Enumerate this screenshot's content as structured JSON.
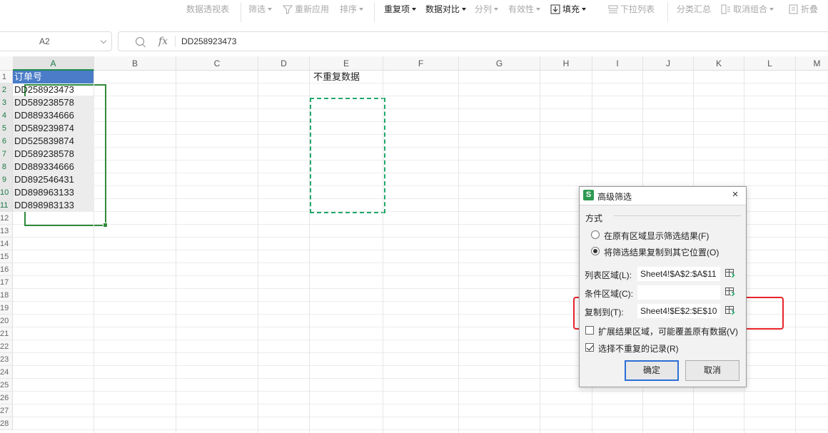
{
  "toolbar": {
    "pivot_table": "数据透视表",
    "filter": "筛选",
    "reapply": "重新应用",
    "sort": "排序",
    "duplicates": "重复项",
    "compare": "数据对比",
    "split_columns": "分列",
    "validity": "有效性",
    "fill": "填充",
    "dropdown_list": "下拉列表",
    "subtotal": "分类汇总",
    "ungroup": "取消组合",
    "fold": "折叠"
  },
  "formula_bar": {
    "name_box": "A2",
    "fx": "fx",
    "value": "DD258923473"
  },
  "sheet": {
    "columns": [
      "A",
      "B",
      "C",
      "D",
      "E",
      "F",
      "G",
      "H",
      "I",
      "J",
      "K",
      "L",
      "M"
    ],
    "row_labels": [
      "1",
      "2",
      "3",
      "4",
      "5",
      "6",
      "7",
      "8",
      "9",
      "10",
      "11",
      "12",
      "13",
      "14",
      "15",
      "16",
      "17",
      "18",
      "19",
      "20",
      "21",
      "22",
      "23",
      "24",
      "25",
      "26",
      "27",
      "28"
    ],
    "a1_header": "订单号",
    "e1_header": "不重复数据",
    "orders": [
      "DD258923473",
      "DD589238578",
      "DD889334666",
      "DD589239874",
      "DD525839874",
      "DD589238578",
      "DD889334666",
      "DD892546431",
      "DD898963133",
      "DD898983133"
    ]
  },
  "dialog": {
    "title": "高级筛选",
    "close": "×",
    "logo": "S",
    "mode_label": "方式",
    "option_in_place": "在原有区域显示筛选结果(F)",
    "option_copy": "将筛选结果复制到其它位置(O)",
    "list_range_label": "列表区域(L):",
    "list_range_value": "Sheet4!$A$2:$A$11",
    "criteria_label": "条件区域(C):",
    "criteria_value": "",
    "copy_to_label": "复制到(T):",
    "copy_to_value": "Sheet4!$E$2:$E$10",
    "expand_label": "扩展结果区域，可能覆盖原有数据(V)",
    "unique_label": "选择不重复的记录(R)",
    "ok": "确定",
    "cancel": "取消"
  },
  "colors": {
    "header_fill": "#4a7cc8",
    "selection": "#2f8b3b",
    "copy_marquee": "#1fa86a",
    "annotation": "#e8242a",
    "primary_button_border": "#2b6fd6"
  }
}
